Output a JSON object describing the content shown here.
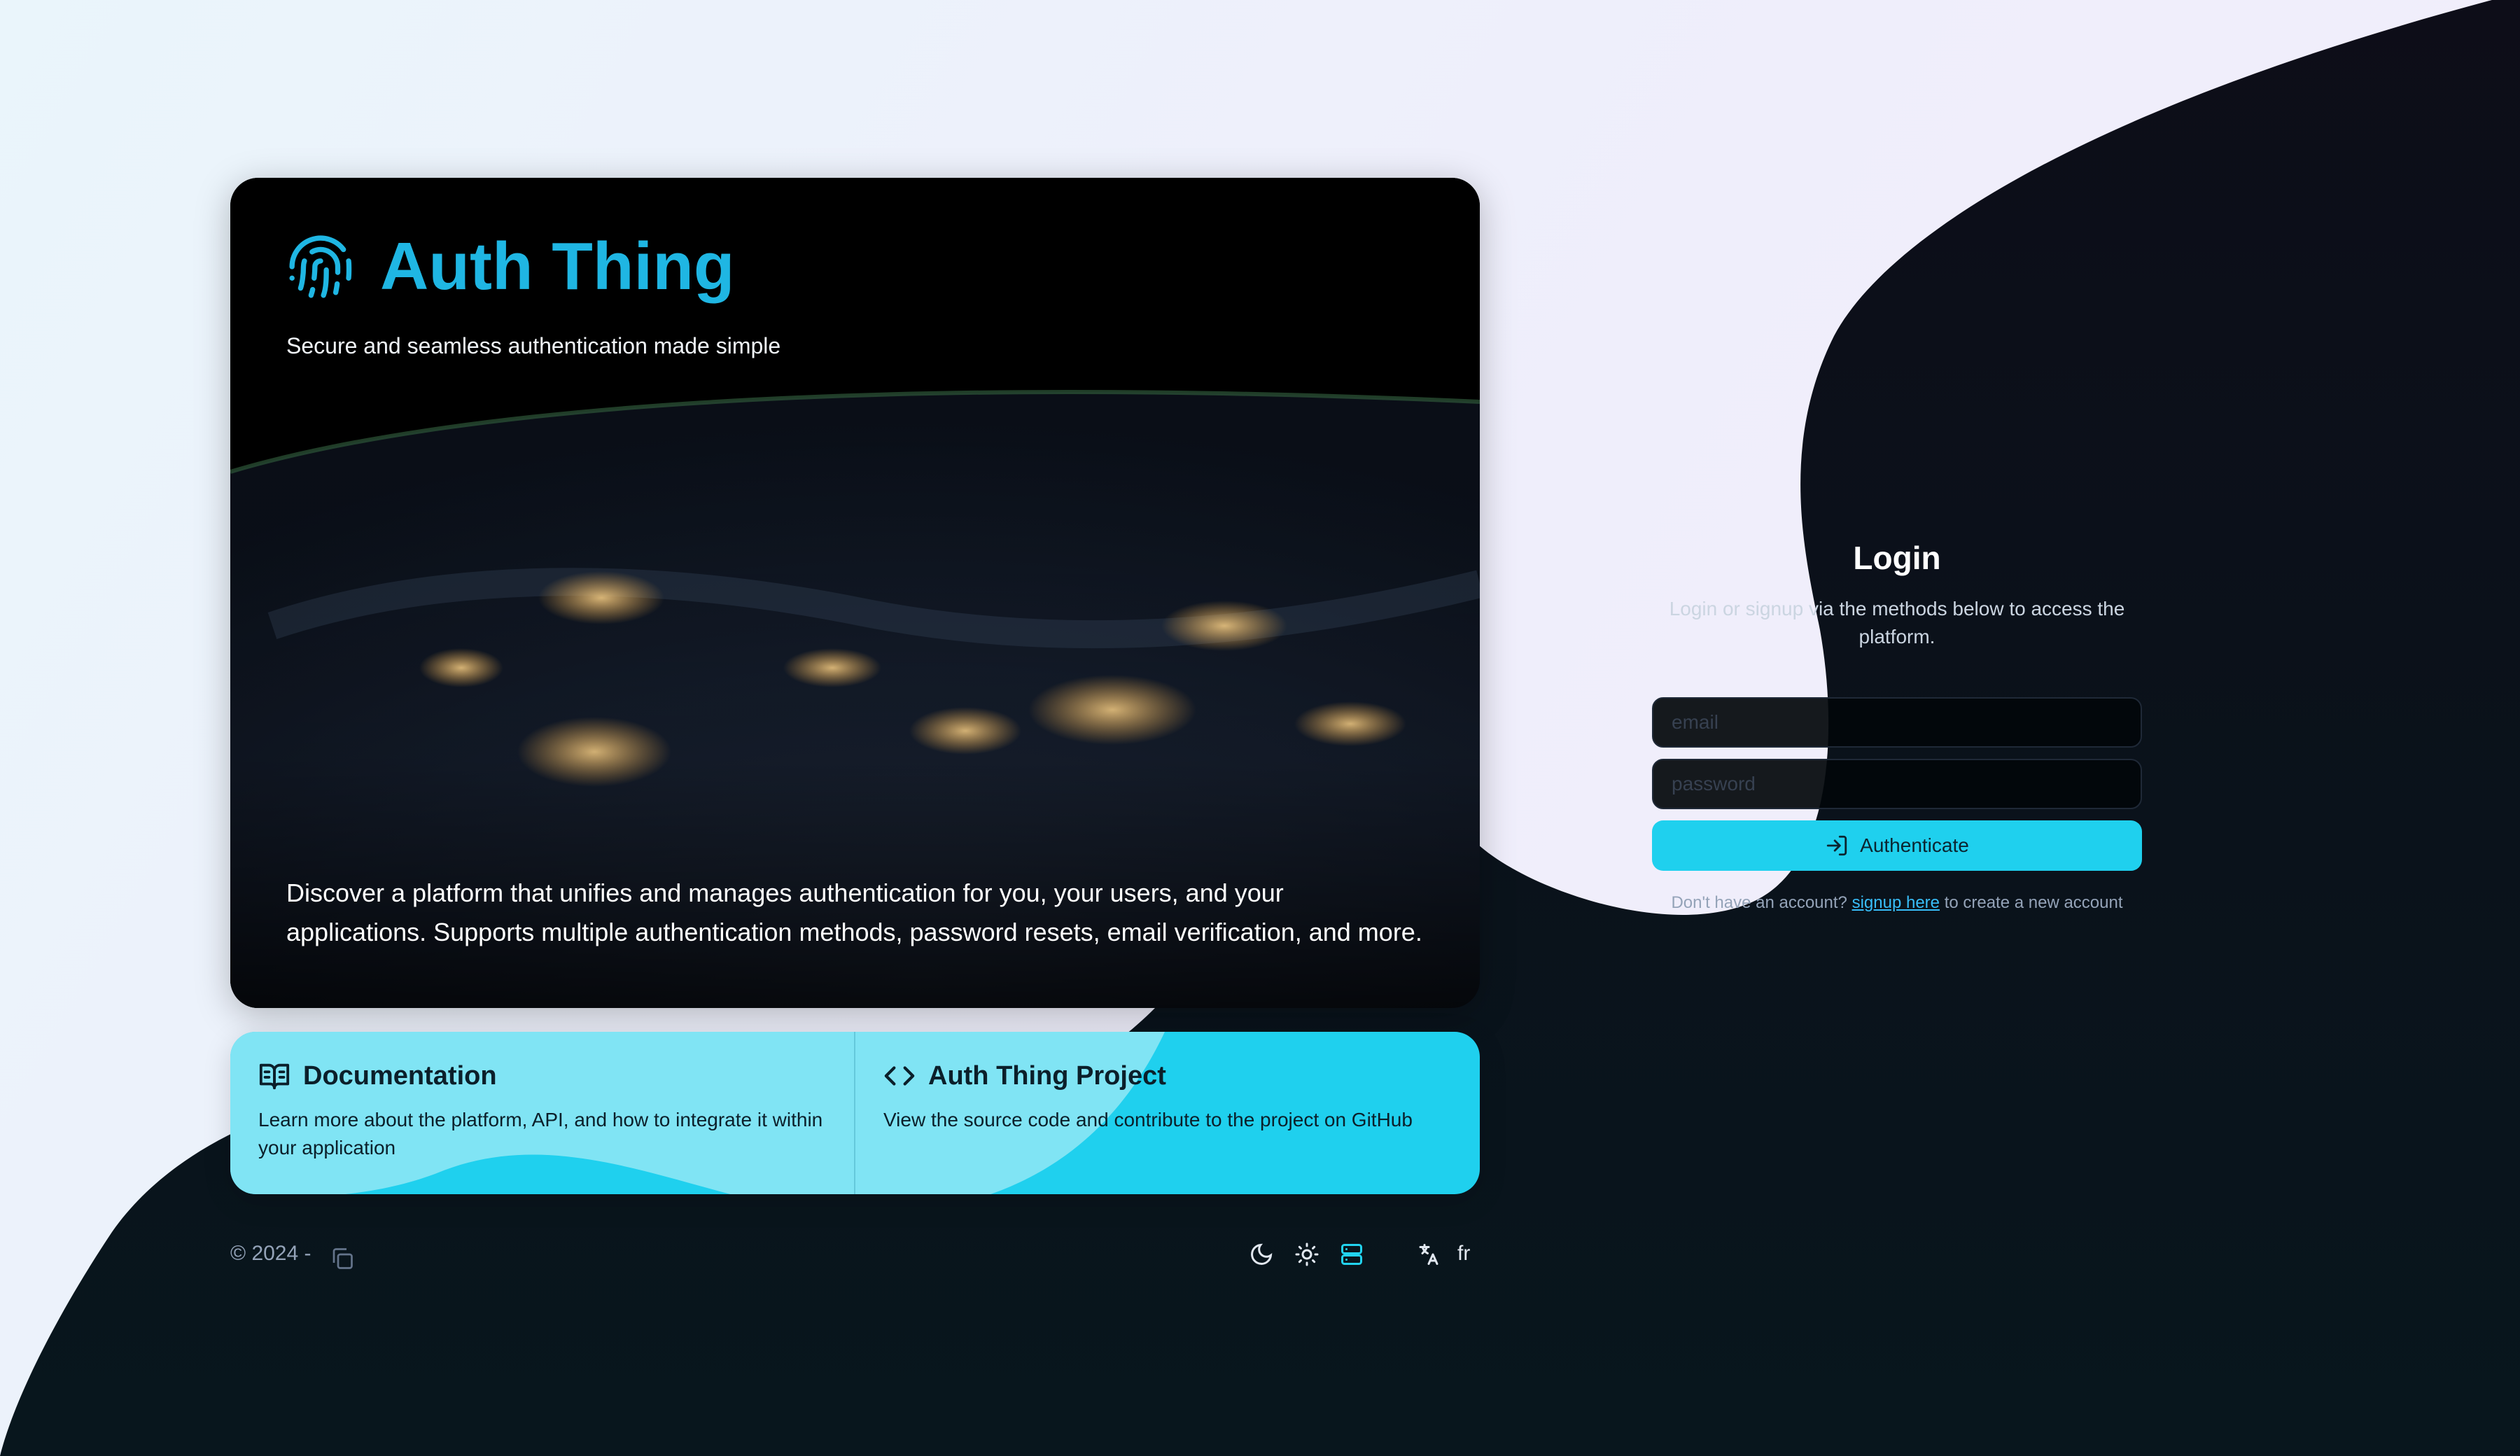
{
  "brand": {
    "title": "Auth Thing",
    "tagline": "Secure and seamless authentication made simple",
    "icon": "fingerprint-icon",
    "accent_color": "#1fb6e3"
  },
  "hero": {
    "description": "Discover a platform that unifies and manages authentication for you, your users, and your applications. Supports multiple authentication methods, password resets, email verification, and more."
  },
  "links": {
    "documentation": {
      "icon": "book-open-icon",
      "title": "Documentation",
      "description": "Learn more about the platform, API, and how to integrate it within your application"
    },
    "project": {
      "icon": "code-icon",
      "title": "Auth Thing Project",
      "description": "View the source code and contribute to the project on GitHub"
    },
    "background_color": "#1fd0ee"
  },
  "footer": {
    "copyright": "© 2024 -",
    "theme_options": [
      "moon-icon",
      "sun-icon",
      "monitor-icon"
    ],
    "active_theme": "system",
    "language_icon": "translate-icon",
    "language_code": "fr"
  },
  "login": {
    "title": "Login",
    "subtitle": "Login or signup via the methods below to access the platform.",
    "email_placeholder": "email",
    "password_placeholder": "password",
    "submit_label": "Authenticate",
    "signup_prefix": "Don't have an account?",
    "signup_link": "signup here",
    "signup_suffix": "to create a new account",
    "button_color": "#1fd0ee"
  }
}
